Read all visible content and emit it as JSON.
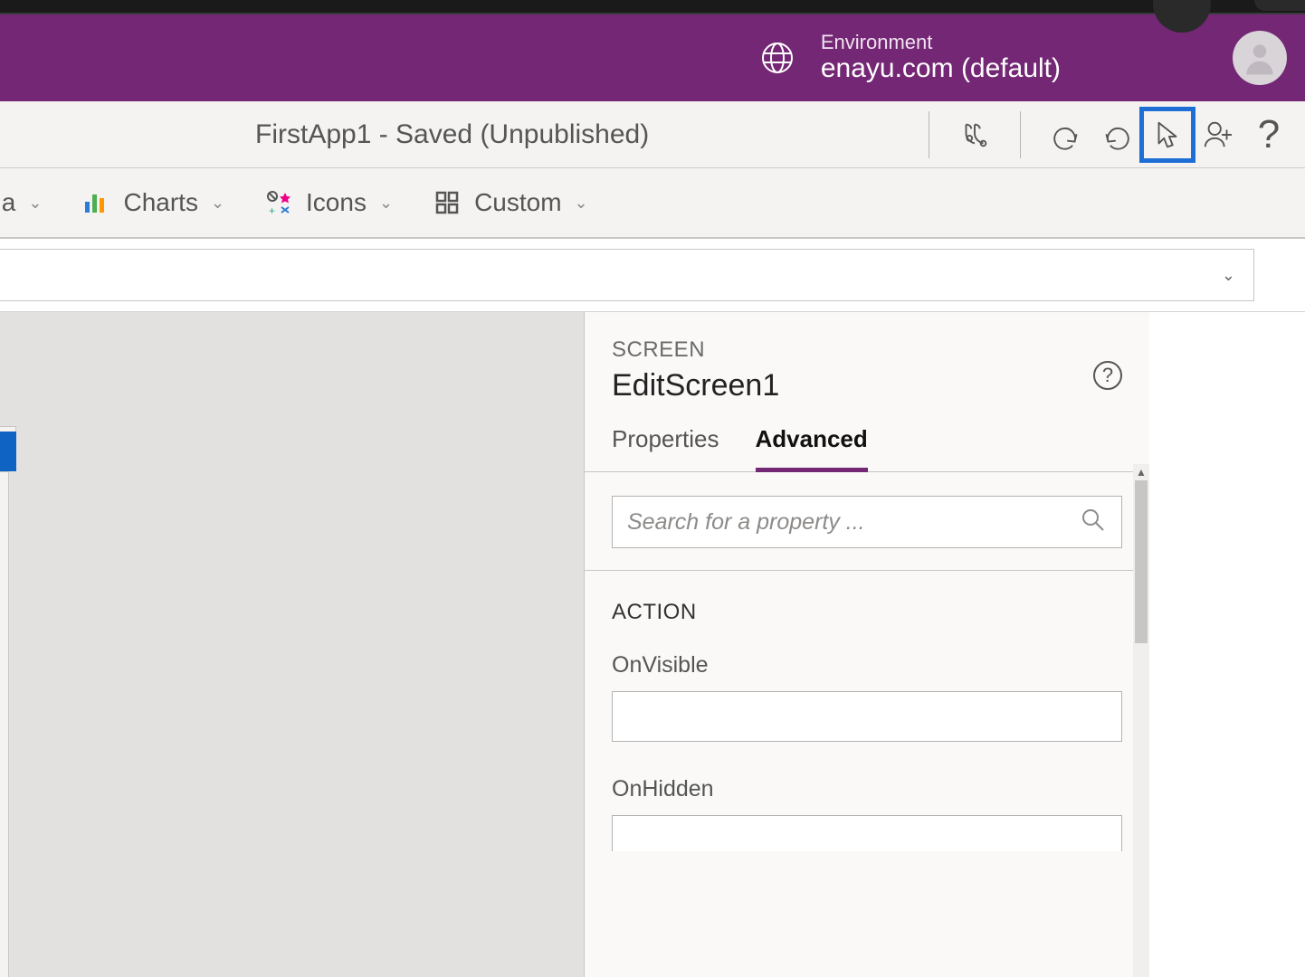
{
  "header": {
    "env_label": "Environment",
    "env_name": "enayu.com (default)"
  },
  "toolbar": {
    "title_text": "FirstApp1 - Saved (Unpublished)"
  },
  "ribbon": {
    "media_label": "dia",
    "charts_label": "Charts",
    "icons_label": "Icons",
    "custom_label": "Custom"
  },
  "panel": {
    "type_label": "SCREEN",
    "screen_name": "EditScreen1",
    "tab_properties": "Properties",
    "tab_advanced": "Advanced",
    "search_placeholder": "Search for a property ...",
    "section_action": "ACTION",
    "prop_onvisible": "OnVisible",
    "prop_onhidden": "OnHidden",
    "help_glyph": "?"
  }
}
